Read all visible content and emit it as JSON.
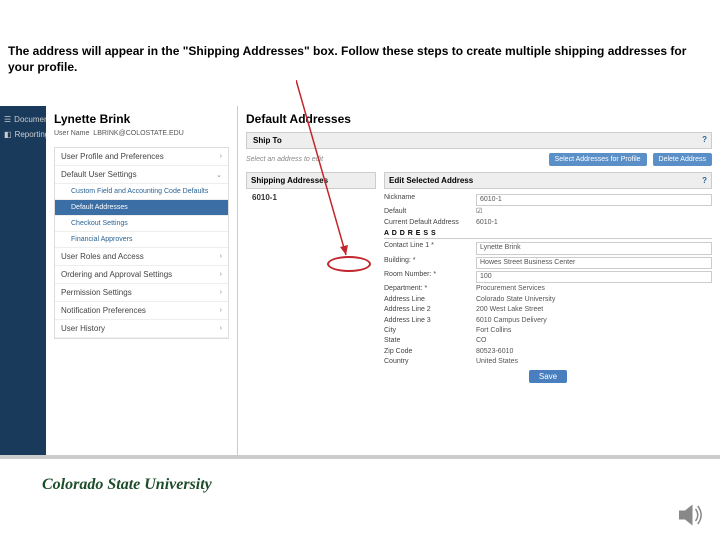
{
  "instruction": "The address will appear in the \"Shipping Addresses\" box.  Follow these steps to create multiple shipping addresses for your profile.",
  "farLeft": {
    "documents": "Documents",
    "reporting": "Reporting"
  },
  "profile": {
    "name": "Lynette Brink",
    "userLabel": "User Name",
    "userName": "LBRINK@COLOSTATE.EDU"
  },
  "menu": {
    "i0": "User Profile and Preferences",
    "i1": "Default User Settings",
    "i1a": "Custom Field and Accounting Code Defaults",
    "i1b": "Default Addresses",
    "i1c": "Checkout Settings",
    "i1d": "Financial Approvers",
    "i2": "User Roles and Access",
    "i3": "Ordering and Approval Settings",
    "i4": "Permission Settings",
    "i5": "Notification Preferences",
    "i6": "User History"
  },
  "main": {
    "title": "Default Addresses",
    "shipTo": "Ship To",
    "selectPrompt": "Select an address to edit",
    "btnSelect": "Select Addresses for Profile",
    "btnDelete": "Delete Address",
    "shipHdr": "Shipping Addresses",
    "entry": "6010-1",
    "editHdr": "Edit Selected Address",
    "questionMark": "?"
  },
  "form": {
    "nickLbl": "Nickname",
    "nickVal": "6010-1",
    "defLbl": "Default",
    "curDefLbl": "Current Default Address",
    "curDefVal": "6010-1",
    "addrHdr": "A D D R E S S",
    "c1Lbl": "Contact Line 1 *",
    "c1Val": "Lynette Brink",
    "bldLbl": "Building: *",
    "bldVal": "Howes Street Business Center",
    "roomLbl": "Room Number: *",
    "roomVal": "100",
    "deptLbl": "Department: *",
    "deptVal": "Procurement Services",
    "alLbl": "Address Line",
    "alVal": "Colorado State University",
    "al2Lbl": "Address Line 2",
    "al2Val": "200 West Lake Street",
    "al3Lbl": "Address Line 3",
    "al3Val": "6010 Campus Delivery",
    "cityLbl": "City",
    "cityVal": "Fort Collins",
    "stLbl": "State",
    "stVal": "CO",
    "zipLbl": "Zip Code",
    "zipVal": "80523-6010",
    "ctryLbl": "Country",
    "ctryVal": "United States",
    "save": "Save"
  },
  "logo": "Colorado State University",
  "chart_data": null
}
